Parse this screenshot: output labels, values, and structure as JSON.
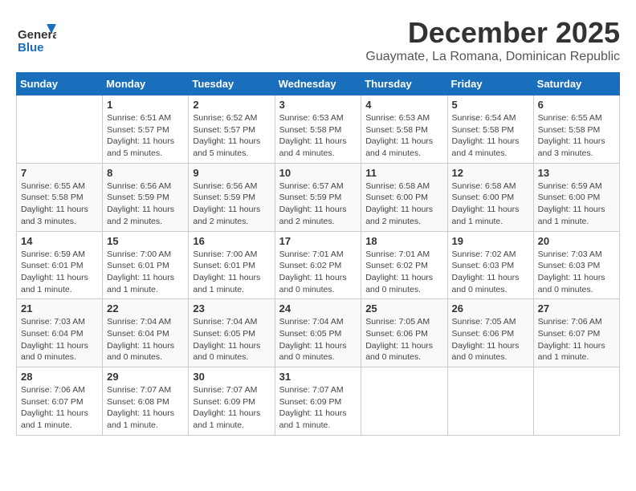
{
  "header": {
    "logo_general": "General",
    "logo_blue": "Blue",
    "month": "December 2025",
    "location": "Guaymate, La Romana, Dominican Republic"
  },
  "days_of_week": [
    "Sunday",
    "Monday",
    "Tuesday",
    "Wednesday",
    "Thursday",
    "Friday",
    "Saturday"
  ],
  "weeks": [
    [
      {
        "day": "",
        "info": ""
      },
      {
        "day": "1",
        "info": "Sunrise: 6:51 AM\nSunset: 5:57 PM\nDaylight: 11 hours\nand 5 minutes."
      },
      {
        "day": "2",
        "info": "Sunrise: 6:52 AM\nSunset: 5:57 PM\nDaylight: 11 hours\nand 5 minutes."
      },
      {
        "day": "3",
        "info": "Sunrise: 6:53 AM\nSunset: 5:58 PM\nDaylight: 11 hours\nand 4 minutes."
      },
      {
        "day": "4",
        "info": "Sunrise: 6:53 AM\nSunset: 5:58 PM\nDaylight: 11 hours\nand 4 minutes."
      },
      {
        "day": "5",
        "info": "Sunrise: 6:54 AM\nSunset: 5:58 PM\nDaylight: 11 hours\nand 4 minutes."
      },
      {
        "day": "6",
        "info": "Sunrise: 6:55 AM\nSunset: 5:58 PM\nDaylight: 11 hours\nand 3 minutes."
      }
    ],
    [
      {
        "day": "7",
        "info": "Sunrise: 6:55 AM\nSunset: 5:58 PM\nDaylight: 11 hours\nand 3 minutes."
      },
      {
        "day": "8",
        "info": "Sunrise: 6:56 AM\nSunset: 5:59 PM\nDaylight: 11 hours\nand 2 minutes."
      },
      {
        "day": "9",
        "info": "Sunrise: 6:56 AM\nSunset: 5:59 PM\nDaylight: 11 hours\nand 2 minutes."
      },
      {
        "day": "10",
        "info": "Sunrise: 6:57 AM\nSunset: 5:59 PM\nDaylight: 11 hours\nand 2 minutes."
      },
      {
        "day": "11",
        "info": "Sunrise: 6:58 AM\nSunset: 6:00 PM\nDaylight: 11 hours\nand 2 minutes."
      },
      {
        "day": "12",
        "info": "Sunrise: 6:58 AM\nSunset: 6:00 PM\nDaylight: 11 hours\nand 1 minute."
      },
      {
        "day": "13",
        "info": "Sunrise: 6:59 AM\nSunset: 6:00 PM\nDaylight: 11 hours\nand 1 minute."
      }
    ],
    [
      {
        "day": "14",
        "info": "Sunrise: 6:59 AM\nSunset: 6:01 PM\nDaylight: 11 hours\nand 1 minute."
      },
      {
        "day": "15",
        "info": "Sunrise: 7:00 AM\nSunset: 6:01 PM\nDaylight: 11 hours\nand 1 minute."
      },
      {
        "day": "16",
        "info": "Sunrise: 7:00 AM\nSunset: 6:01 PM\nDaylight: 11 hours\nand 1 minute."
      },
      {
        "day": "17",
        "info": "Sunrise: 7:01 AM\nSunset: 6:02 PM\nDaylight: 11 hours\nand 0 minutes."
      },
      {
        "day": "18",
        "info": "Sunrise: 7:01 AM\nSunset: 6:02 PM\nDaylight: 11 hours\nand 0 minutes."
      },
      {
        "day": "19",
        "info": "Sunrise: 7:02 AM\nSunset: 6:03 PM\nDaylight: 11 hours\nand 0 minutes."
      },
      {
        "day": "20",
        "info": "Sunrise: 7:03 AM\nSunset: 6:03 PM\nDaylight: 11 hours\nand 0 minutes."
      }
    ],
    [
      {
        "day": "21",
        "info": "Sunrise: 7:03 AM\nSunset: 6:04 PM\nDaylight: 11 hours\nand 0 minutes."
      },
      {
        "day": "22",
        "info": "Sunrise: 7:04 AM\nSunset: 6:04 PM\nDaylight: 11 hours\nand 0 minutes."
      },
      {
        "day": "23",
        "info": "Sunrise: 7:04 AM\nSunset: 6:05 PM\nDaylight: 11 hours\nand 0 minutes."
      },
      {
        "day": "24",
        "info": "Sunrise: 7:04 AM\nSunset: 6:05 PM\nDaylight: 11 hours\nand 0 minutes."
      },
      {
        "day": "25",
        "info": "Sunrise: 7:05 AM\nSunset: 6:06 PM\nDaylight: 11 hours\nand 0 minutes."
      },
      {
        "day": "26",
        "info": "Sunrise: 7:05 AM\nSunset: 6:06 PM\nDaylight: 11 hours\nand 0 minutes."
      },
      {
        "day": "27",
        "info": "Sunrise: 7:06 AM\nSunset: 6:07 PM\nDaylight: 11 hours\nand 1 minute."
      }
    ],
    [
      {
        "day": "28",
        "info": "Sunrise: 7:06 AM\nSunset: 6:07 PM\nDaylight: 11 hours\nand 1 minute."
      },
      {
        "day": "29",
        "info": "Sunrise: 7:07 AM\nSunset: 6:08 PM\nDaylight: 11 hours\nand 1 minute."
      },
      {
        "day": "30",
        "info": "Sunrise: 7:07 AM\nSunset: 6:09 PM\nDaylight: 11 hours\nand 1 minute."
      },
      {
        "day": "31",
        "info": "Sunrise: 7:07 AM\nSunset: 6:09 PM\nDaylight: 11 hours\nand 1 minute."
      },
      {
        "day": "",
        "info": ""
      },
      {
        "day": "",
        "info": ""
      },
      {
        "day": "",
        "info": ""
      }
    ]
  ]
}
